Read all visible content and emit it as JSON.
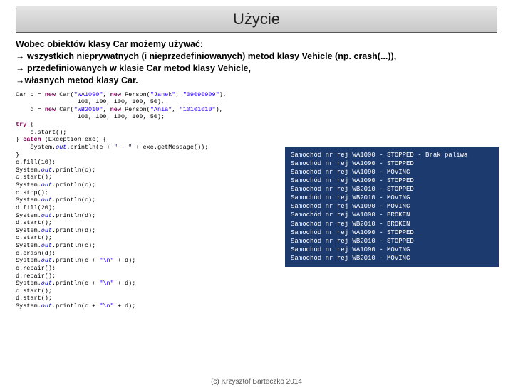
{
  "title": "Użycie",
  "desc_lines": [
    "Wobec obiektów klasy Car możemy używać:",
    "→ wszystkich nieprywatnych (i nieprzedefiniowanych) metod klasy Vehicle (np. crash(...)),",
    "→ przedefiniowanych w klasie Car metod klasy Vehicle,",
    "→własnych metod klasy Car."
  ],
  "code": {
    "l1a": "Car c = ",
    "l1_new1": "new",
    "l1b": " Car(",
    "l1_s1": "\"WA1090\"",
    "l1c": ", ",
    "l1_new2": "new",
    "l1d": " Person(",
    "l1_s2": "\"Janek\"",
    "l1e": ", ",
    "l1_s3": "\"09090909\"",
    "l1f": "),",
    "l2": "                 100, 100, 100, 100, 50),",
    "l3a": "    d = ",
    "l3_new1": "new",
    "l3b": " Car(",
    "l3_s1": "\"WB2010\"",
    "l3c": ", ",
    "l3_new2": "new",
    "l3d": " Person(",
    "l3_s2": "\"Ania\"",
    "l3e": ", ",
    "l3_s3": "\"10101010\"",
    "l3f": "),",
    "l4": "                 100, 100, 100, 100, 50);",
    "l5_try": "try",
    "l5b": " {",
    "l6": "    c.start();",
    "l7a": "} ",
    "l7_catch": "catch",
    "l7b": " (Exception exc) {",
    "l8a": "    System.",
    "l8_out": "out",
    "l8b": ".println(c + ",
    "l8_s1": "\" - \"",
    "l8c": " + exc.getMessage());",
    "l9": "}",
    "l10": "c.fill(10);",
    "l11a": "System.",
    "l11_out": "out",
    "l11b": ".println(c);",
    "l12": "c.start();",
    "l13a": "System.",
    "l13_out": "out",
    "l13b": ".println(c);",
    "l14": "c.stop();",
    "l15a": "System.",
    "l15_out": "out",
    "l15b": ".println(c);",
    "l16": "d.fill(20);",
    "l17a": "System.",
    "l17_out": "out",
    "l17b": ".println(d);",
    "l18": "d.start();",
    "l19a": "System.",
    "l19_out": "out",
    "l19b": ".println(d);",
    "l20": "c.start();",
    "l21a": "System.",
    "l21_out": "out",
    "l21b": ".println(c);",
    "l22": "c.crash(d);",
    "l23a": "System.",
    "l23_out": "out",
    "l23b": ".println(c + ",
    "l23_s": "\"\\n\"",
    "l23c": " + d);",
    "l24": "c.repair();",
    "l25": "d.repair();",
    "l26a": "System.",
    "l26_out": "out",
    "l26b": ".println(c + ",
    "l26_s": "\"\\n\"",
    "l26c": " + d);",
    "l27": "c.start();",
    "l28": "d.start();",
    "l29a": "System.",
    "l29_out": "out",
    "l29b": ".println(c + ",
    "l29_s": "\"\\n\"",
    "l29c": " + d);"
  },
  "console_lines": [
    "Samochód nr rej WA1090 - STOPPED - Brak paliwa",
    "Samochód nr rej WA1090 - STOPPED",
    "Samochód nr rej WA1090 - MOVING",
    "Samochód nr rej WA1090 - STOPPED",
    "Samochód nr rej WB2010 - STOPPED",
    "Samochód nr rej WB2010 - MOVING",
    "Samochód nr rej WA1090 - MOVING",
    "Samochód nr rej WA1090 - BROKEN",
    "Samochód nr rej WB2010 - BROKEN",
    "Samochód nr rej WA1090 - STOPPED",
    "Samochód nr rej WB2010 - STOPPED",
    "Samochód nr rej WA1090 - MOVING",
    "Samochód nr rej WB2010 - MOVING"
  ],
  "footer": "(c) Krzysztof Barteczko 2014"
}
